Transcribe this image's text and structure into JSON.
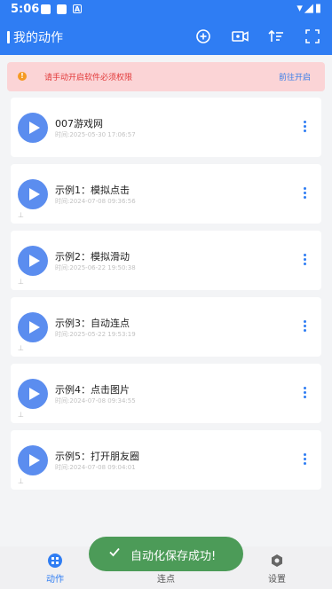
{
  "status_bar": {
    "time": "5:06",
    "app_icon_letter": "A",
    "right_icons": "▾◢▮"
  },
  "app_bar": {
    "title": "我的动作"
  },
  "alert": {
    "text": "请手动开启软件必须权限",
    "link": "前往开启",
    "icon": "!"
  },
  "items": [
    {
      "title": "007游戏网",
      "time": "时间:2025-05-30 17:06:57",
      "pinned": false
    },
    {
      "title": "示例1：模拟点击",
      "time": "时间:2024-07-08 09:36:56",
      "pinned": true
    },
    {
      "title": "示例2：模拟滑动",
      "time": "时间:2025-06-22 19:50:38",
      "pinned": true
    },
    {
      "title": "示例3：自动连点",
      "time": "时间:2025-05-22 19:53:19",
      "pinned": true
    },
    {
      "title": "示例4：点击图片",
      "time": "时间:2024-07-08 09:34:55",
      "pinned": true
    },
    {
      "title": "示例5：打开朋友圈",
      "time": "时间:2024-07-08 09:04:01",
      "pinned": true
    }
  ],
  "pin_icon": "⊥",
  "nav": [
    {
      "label": "动作",
      "icon": "grid-icon",
      "active": true
    },
    {
      "label": "连点",
      "icon": "tap-icon",
      "active": false
    },
    {
      "label": "设置",
      "icon": "gear-icon",
      "active": false
    }
  ],
  "toast": {
    "text": "自动化保存成功!"
  },
  "colors": {
    "primary": "#2f7df3",
    "alert_bg": "#fbd4d6",
    "toast_bg": "#4c9b58"
  }
}
